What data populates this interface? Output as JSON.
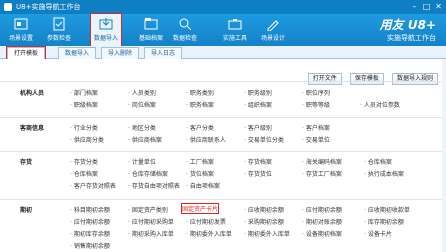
{
  "window": {
    "title": "U8+实施导航工作台"
  },
  "ribbon": {
    "items": [
      {
        "label": "场景设置"
      },
      {
        "label": "参数检查"
      },
      {
        "label": "数据导入"
      },
      {
        "label": "基础档案"
      },
      {
        "label": "数据检查"
      },
      {
        "label": "实施工具"
      },
      {
        "label": "场景设计"
      }
    ]
  },
  "brand": {
    "line1": "用友 U8+",
    "line2": "实施导航工作台"
  },
  "tabs": [
    {
      "label": "打开模板"
    },
    {
      "label": "数据导入"
    },
    {
      "label": "导入删除"
    },
    {
      "label": "导入日志"
    }
  ],
  "toolbar": {
    "open_file": "打开文件",
    "save_template": "保存模板",
    "import_rule": "数据导入规则"
  },
  "sections": [
    {
      "label": "机构人员",
      "items": [
        [
          "部门档案",
          "人员类别",
          "职务类别",
          "职务级别",
          "职位序列"
        ],
        [
          "职级档案",
          "岗位档案",
          "职务档案",
          "组织档案",
          "职等等级",
          "人员对位参数"
        ]
      ]
    },
    {
      "label": "客商信息",
      "items": [
        [
          "行业分类",
          "地区分类",
          "客户分类",
          "客户级别",
          "客户档案"
        ],
        [
          "供应商分类",
          "供应商档案",
          "供应商联系人",
          "交易单位分类",
          "交易单位"
        ]
      ]
    },
    {
      "label": "存货",
      "items": [
        [
          "存货分类",
          "计量单位",
          "工厂档案",
          "存货档案",
          "海关编码档案",
          "仓库档案"
        ],
        [
          "仓库档案",
          "仓库存储档案",
          "货位档案",
          "存货货位",
          "存货工厂档案",
          "执行成本档案"
        ],
        [
          "客户存货对照表",
          "存货自由项对照表",
          "自由项档案"
        ]
      ]
    },
    {
      "label": "期初",
      "items": [
        [
          "科目期初余额",
          "固定资产类别",
          "固定资产卡片",
          "应收期初余额",
          "应付期初余额",
          "应收期初收款单"
        ],
        [
          "应付期初余额",
          "应付期初采购单",
          "应付期初发票",
          "采购期初余额",
          "期初对账余额",
          "库存期初余额"
        ],
        [
          "期初库存余额",
          "期初采购入库单",
          "期初委外入库单",
          "期初委外入库单",
          "设备期初档案",
          "设备卡片"
        ],
        [
          "销售期初余额"
        ]
      ]
    }
  ]
}
